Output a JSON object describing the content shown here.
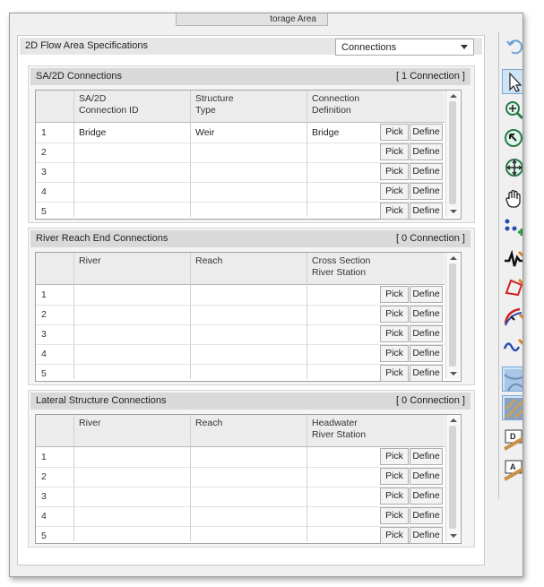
{
  "window": {
    "top_tab_label": "torage Area"
  },
  "spec": {
    "title": "2D Flow Area Specifications",
    "dropdown_value": "Connections"
  },
  "groups": [
    {
      "title": "SA/2D Connections",
      "count": "[ 1 Connection ]",
      "columns": [
        "SA/2D\nConnection ID",
        "Structure\nType",
        "Connection\nDefinition"
      ],
      "rows": [
        {
          "num": "1",
          "c1": "Bridge",
          "c2": "Weir",
          "c3": "Bridge"
        },
        {
          "num": "2",
          "c1": "",
          "c2": "",
          "c3": ""
        },
        {
          "num": "3",
          "c1": "",
          "c2": "",
          "c3": ""
        },
        {
          "num": "4",
          "c1": "",
          "c2": "",
          "c3": ""
        },
        {
          "num": "5",
          "c1": "",
          "c2": "",
          "c3": ""
        }
      ]
    },
    {
      "title": "River Reach End Connections",
      "count": "[ 0 Connection ]",
      "columns": [
        "River",
        "Reach",
        "Cross Section\nRiver Station"
      ],
      "rows": [
        {
          "num": "1",
          "c1": "",
          "c2": "",
          "c3": ""
        },
        {
          "num": "2",
          "c1": "",
          "c2": "",
          "c3": ""
        },
        {
          "num": "3",
          "c1": "",
          "c2": "",
          "c3": ""
        },
        {
          "num": "4",
          "c1": "",
          "c2": "",
          "c3": ""
        },
        {
          "num": "5",
          "c1": "",
          "c2": "",
          "c3": ""
        }
      ]
    },
    {
      "title": "Lateral Structure Connections",
      "count": "[ 0 Connection ]",
      "columns": [
        "River",
        "Reach",
        "Headwater\nRiver Station"
      ],
      "rows": [
        {
          "num": "1",
          "c1": "",
          "c2": "",
          "c3": ""
        },
        {
          "num": "2",
          "c1": "",
          "c2": "",
          "c3": ""
        },
        {
          "num": "3",
          "c1": "",
          "c2": "",
          "c3": ""
        },
        {
          "num": "4",
          "c1": "",
          "c2": "",
          "c3": ""
        },
        {
          "num": "5",
          "c1": "",
          "c2": "",
          "c3": ""
        }
      ]
    }
  ],
  "buttons": {
    "pick": "Pick",
    "define": "Define"
  },
  "toolbar": {
    "tools": [
      "undo-icon",
      "select-arrow-icon",
      "zoom-icon",
      "pan-arrow-icon",
      "move-cross-icon",
      "hand-icon",
      "add-points-icon",
      "profile-line-icon",
      "polygon-edit-icon",
      "flow-path-icon",
      "wave-line-icon",
      "map-layer-icon",
      "terrain-layer-icon",
      "d-measure-icon",
      "a-measure-icon"
    ]
  }
}
